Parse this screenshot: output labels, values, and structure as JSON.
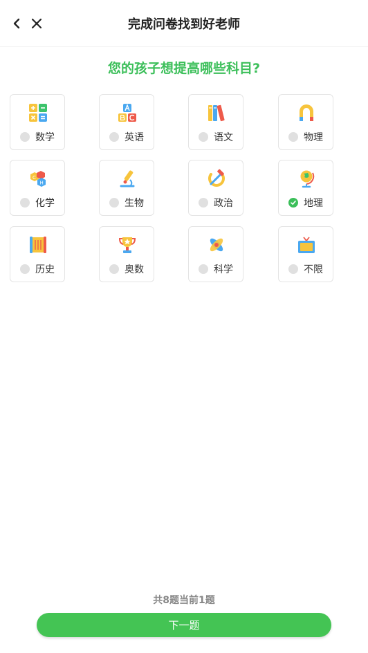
{
  "header": {
    "title": "完成问卷找到好老师",
    "back_icon": "chevron-left-icon",
    "close_icon": "close-icon"
  },
  "question": "您的孩子想提高哪些科目?",
  "subjects": [
    {
      "label": "数学",
      "icon": "math-icon",
      "selected": false
    },
    {
      "label": "英语",
      "icon": "abc-blocks-icon",
      "selected": false
    },
    {
      "label": "语文",
      "icon": "books-icon",
      "selected": false
    },
    {
      "label": "物理",
      "icon": "magnet-icon",
      "selected": false
    },
    {
      "label": "化学",
      "icon": "molecule-icon",
      "selected": false
    },
    {
      "label": "生物",
      "icon": "microscope-icon",
      "selected": false
    },
    {
      "label": "政治",
      "icon": "hammer-sickle-icon",
      "selected": false
    },
    {
      "label": "地理",
      "icon": "globe-icon",
      "selected": true
    },
    {
      "label": "历史",
      "icon": "scroll-icon",
      "selected": false
    },
    {
      "label": "奥数",
      "icon": "trophy-icon",
      "selected": false
    },
    {
      "label": "科学",
      "icon": "atom-icon",
      "selected": false
    },
    {
      "label": "不限",
      "icon": "tv-icon",
      "selected": false
    }
  ],
  "footer": {
    "progress": "共8题当前1题",
    "next_label": "下一题"
  },
  "colors": {
    "accent": "#3cbf5a",
    "button": "#44c454"
  }
}
